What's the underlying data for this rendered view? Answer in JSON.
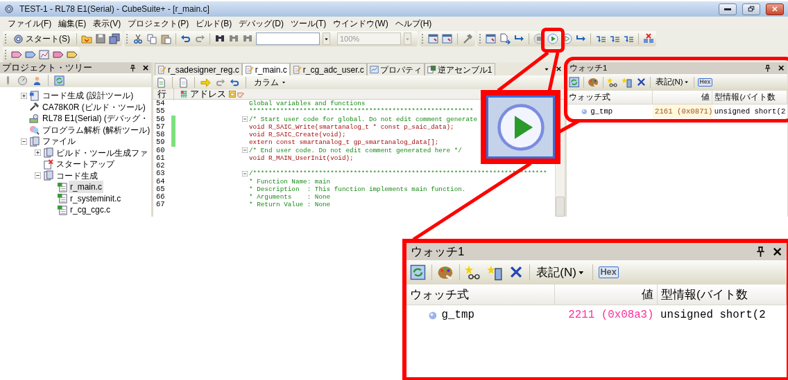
{
  "window": {
    "title": "TEST-1 - RL78 E1(Serial) - CubeSuite+ - [r_main.c]"
  },
  "menu": [
    "ファイル(F)",
    "編集(E)",
    "表示(V)",
    "プロジェクト(P)",
    "ビルド(B)",
    "デバッグ(D)",
    "ツール(T)",
    "ウインドウ(W)",
    "ヘルプ(H)"
  ],
  "toolbar": {
    "start_label": "スタート(S)",
    "zoom": {
      "value": "100%",
      "disabled": true
    }
  },
  "project_tree": {
    "title": "プロジェクト・ツリー",
    "items": [
      {
        "label": "コード生成 (設計ツール)",
        "kind": "codegen",
        "expanded": false,
        "selected": false
      },
      {
        "label": "CA78K0R (ビルド・ツール)",
        "kind": "build-tool",
        "selected": false
      },
      {
        "label": "RL78 E1(Serial) (デバッグ・",
        "kind": "debug-tool",
        "selected": false
      },
      {
        "label": "プログラム解析 (解析ツール)",
        "kind": "analysis",
        "selected": false
      },
      {
        "label": "ファイル",
        "kind": "folder",
        "expanded": true,
        "selected": false,
        "children": [
          {
            "label": "ビルド・ツール生成ファ",
            "kind": "folder",
            "expanded": false,
            "selected": false
          },
          {
            "label": "スタートアップ",
            "kind": "startup",
            "selected": false
          },
          {
            "label": "コード生成",
            "kind": "folder",
            "expanded": true,
            "selected": false,
            "children": [
              {
                "label": "r_main.c",
                "kind": "source",
                "selected": true
              },
              {
                "label": "r_systeminit.c",
                "kind": "source",
                "selected": false
              },
              {
                "label": "r_cg_cgc.c",
                "kind": "source",
                "selected": false
              }
            ]
          }
        ]
      }
    ]
  },
  "editor": {
    "tabs": [
      {
        "label": "r_sadesigner_reg.c",
        "kind": "file",
        "selected": false
      },
      {
        "label": "r_main.c",
        "kind": "file",
        "selected": true
      },
      {
        "label": "r_cg_adc_user.c",
        "kind": "file",
        "selected": false
      },
      {
        "label": "プロパティ",
        "kind": "properties",
        "selected": false
      },
      {
        "label": "逆アセンブル1",
        "kind": "disassembly",
        "selected": false
      }
    ],
    "column_button": "カラム",
    "column_headers": [
      "行",
      "アドレス"
    ],
    "lines": [
      {
        "number": "54",
        "text": "Global variables and functions",
        "kind": "comment",
        "modified": false,
        "fold": false
      },
      {
        "number": "55",
        "text": "**********************************************************",
        "kind": "comment",
        "modified": false,
        "fold": false
      },
      {
        "number": "56",
        "text": "/* Start user code for global. Do not edit comment generate",
        "kind": "comment",
        "modified": true,
        "fold": true
      },
      {
        "number": "57",
        "text": "void R_SAIC_Write(smartanalog_t * const p_saic_data);",
        "kind": "code",
        "modified": true,
        "fold": false
      },
      {
        "number": "58",
        "text": "void R_SAIC_Create(void);",
        "kind": "code",
        "modified": true,
        "fold": false
      },
      {
        "number": "59",
        "text": "extern const smartanalog_t gp_smartanalog_data[];",
        "kind": "code",
        "modified": true,
        "fold": false
      },
      {
        "number": "60",
        "text": "/* End user code. Do not edit comment generated here */",
        "kind": "comment",
        "modified": false,
        "fold": true
      },
      {
        "number": "61",
        "text": "void R_MAIN_UserInit(void);",
        "kind": "code",
        "modified": false,
        "fold": false
      },
      {
        "number": "62",
        "kind": "code",
        "modified": false,
        "fold": false
      },
      {
        "number": "63",
        "text": "/****************************************************************************",
        "kind": "comment",
        "modified": false,
        "fold": true
      },
      {
        "number": "64",
        "text": "* Function Name: main",
        "kind": "comment",
        "modified": false,
        "fold": false
      },
      {
        "number": "65",
        "text": "* Description  : This function implements main function.",
        "kind": "comment",
        "modified": false,
        "fold": false
      },
      {
        "number": "66",
        "text": "* Arguments    : None",
        "kind": "comment",
        "modified": false,
        "fold": false
      },
      {
        "number": "67",
        "text": "* Return Value : None",
        "kind": "comment",
        "modified": false,
        "fold": false
      }
    ]
  },
  "watch_panel": {
    "title": "ウォッチ1",
    "notation_label": "表記(N)",
    "hex_label": "Hex",
    "hex_on": true,
    "columns": [
      "ウォッチ式",
      "値",
      "型情報(バイト数"
    ],
    "rows": [
      {
        "name": "g_tmp",
        "value": "2161 (0x0871)",
        "type": "unsigned short(2",
        "changed": false
      }
    ]
  },
  "zoomed_watch": {
    "title": "ウォッチ1",
    "notation_label": "表記(N)",
    "hex_label": "Hex",
    "hex_on": true,
    "columns": [
      "ウォッチ式",
      "値",
      "型情報(バイト数"
    ],
    "rows": [
      {
        "name": "g_tmp",
        "value": "2211 (0x08a3)",
        "type": "unsigned short(2",
        "changed": true
      }
    ]
  }
}
